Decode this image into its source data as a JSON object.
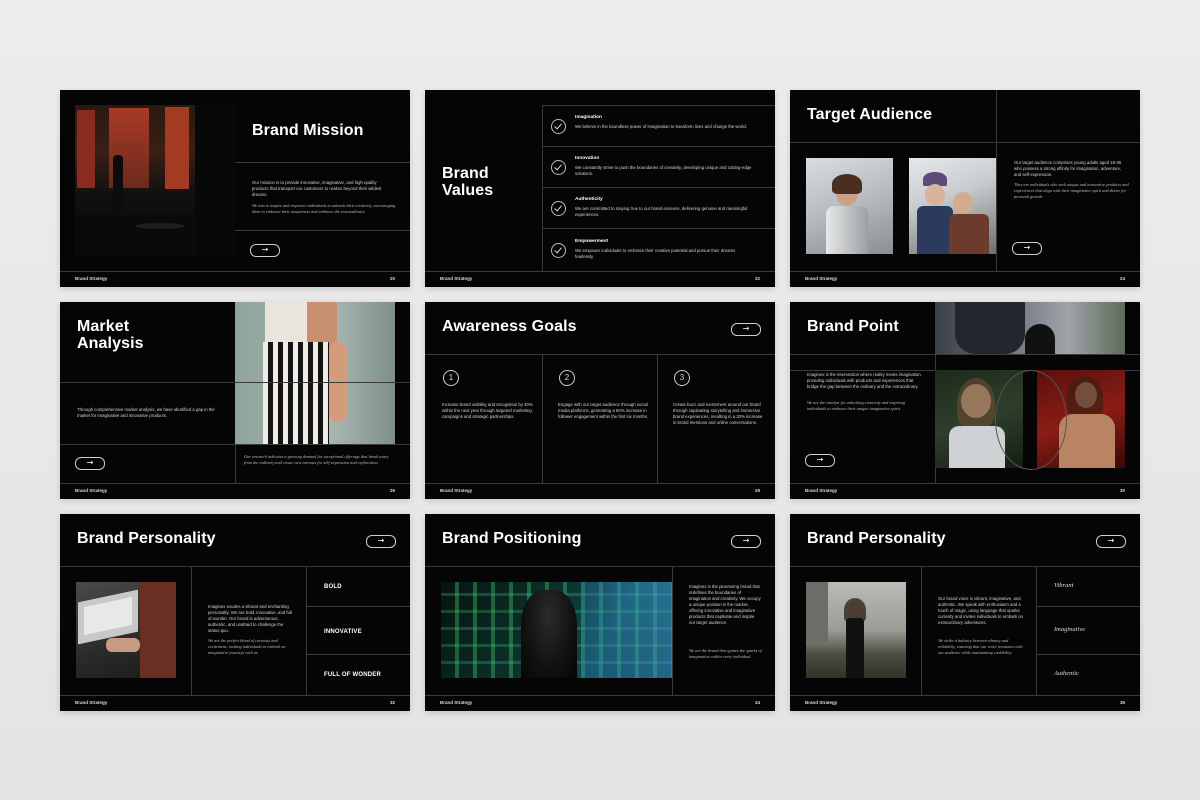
{
  "footer_label": "Brand Strategy",
  "slides": {
    "mission": {
      "title": "Brand Mission",
      "body": "Our mission is to provide innovative, imaginative, and high-quality products that transport our customers to realms beyond their wildest dreams.",
      "quote": "We aim to inspire and empower individuals to unleash their creativity, encouraging them to embrace their uniqueness and embrace the extraordinary.",
      "page": "20"
    },
    "values": {
      "title_line1": "Brand",
      "title_line2": "Values",
      "items": [
        {
          "heading": "Imagination",
          "text": "We believe in the boundless power of imagination to transform lives and change the world."
        },
        {
          "heading": "Innovation",
          "text": "We constantly strive to push the boundaries of creativity, developing unique and cutting-edge solutions."
        },
        {
          "heading": "Authenticity",
          "text": "We are committed to staying true to our brand essence, delivering genuine and meaningful experiences."
        },
        {
          "heading": "Empowerment",
          "text": "We empower individuals to embrace their creative potential and pursue their dreams fearlessly."
        }
      ],
      "page": "22"
    },
    "audience": {
      "title": "Target Audience",
      "body": "Our target audience comprises young adults aged 18-35 who possess a strong affinity for imagination, adventure, and self-expression.",
      "quote": "They are individuals who seek unique and innovative products and experiences that align with their imaginative spirit and desire for personal growth.",
      "page": "24"
    },
    "market": {
      "title_line1": "Market",
      "title_line2": "Analysis",
      "body": "Through comprehensive market analysis, we have identified a gap in the market for imaginative and innovative products.",
      "quote": "Our research indicates a growing demand for exceptional offerings that break away from the ordinary and create new avenues for self-expression and exploration.",
      "page": "26"
    },
    "awareness": {
      "title": "Awareness Goals",
      "goals": [
        {
          "num": "1",
          "text": "Increase brand visibility and recognition by 40% within the next year through targeted marketing campaigns and strategic partnerships."
        },
        {
          "num": "2",
          "text": "Engage with our target audience through social media platforms, generating a 50% increase in follower engagement within the first six months."
        },
        {
          "num": "3",
          "text": "Create buzz and excitement around our brand through captivating storytelling and immersive brand experiences, resulting in a 30% increase in brand mentions and online conversations."
        }
      ],
      "page": "28"
    },
    "point": {
      "title": "Brand Point",
      "body": "Imaginex is the intersection where reality meets imagination, providing individuals with products and experiences that bridge the gap between the ordinary and the extraordinary.",
      "quote": "We are the catalyst for unlocking creativity and inspiring individuals to embrace their unique imaginative spirit.",
      "page": "30"
    },
    "personality1": {
      "title": "Brand Personality",
      "body": "Imaginex exudes a vibrant and enchanting personality. We are bold, innovative, and full of wonder. Our brand is adventurous, authentic, and unafraid to challenge the status quo.",
      "quote": "We are the perfect blend of curiosity and excitement, inviting individuals to embark on imaginative journeys with us.",
      "labels": [
        "BOLD",
        "INNOVATIVE",
        "FULL OF WONDER"
      ],
      "page": "32"
    },
    "positioning": {
      "title": "Brand Positioning",
      "body": "Imaginex is the pioneering brand that redefines the boundaries of imagination and creativity. We occupy a unique position in the market, offering innovative and imaginative products that captivate and inspire our target audience.",
      "quote": "We are the brand that ignites the sparks of imagination within every individual.",
      "page": "34"
    },
    "personality2": {
      "title": "Brand Personality",
      "body": "Our brand voice is vibrant, imaginative, and authentic. We speak with enthusiasm and a touch of magic, using language that sparks curiosity and invites individuals to embark on extraordinary adventures.",
      "quote": "We strike a balance between whimsy and reliability, ensuring that our voice resonates with our audience while maintaining credibility.",
      "labels": [
        "Vibrant",
        "Imaginative",
        "Authentic"
      ],
      "page": "36"
    }
  },
  "colors": {
    "slide_bg": "#050505",
    "page_bg": "#e8e8e8",
    "line": "#3a3a3a"
  }
}
